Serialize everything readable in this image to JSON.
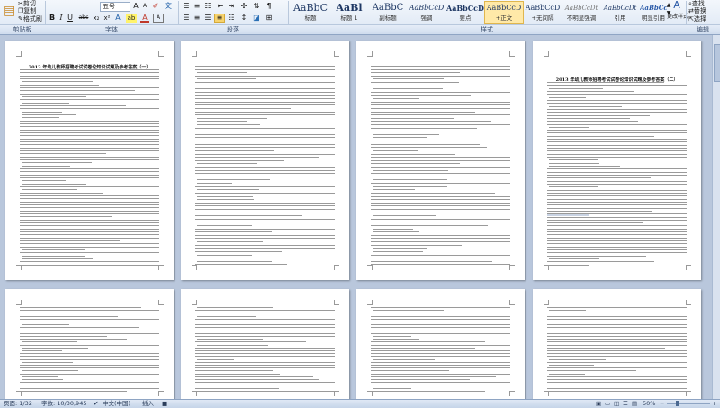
{
  "ribbon": {
    "clipboard": {
      "items": [
        "剪切",
        "复制",
        "格式刷"
      ],
      "label": "剪贴板"
    },
    "font": {
      "name_value": "五号",
      "label": "字体",
      "buttons": [
        "B",
        "I",
        "U",
        "abc",
        "x₂",
        "x²",
        "A"
      ]
    },
    "paragraph": {
      "label": "段落"
    },
    "styles": {
      "label": "样式",
      "tiles": [
        {
          "sample": "AaBbC",
          "name": "标题"
        },
        {
          "sample": "AaBl",
          "name": "标题 1"
        },
        {
          "sample": "AaBbC",
          "name": "副标题"
        },
        {
          "sample": "AaBbCcD",
          "name": "强调"
        },
        {
          "sample": "AaBbCcD",
          "name": "要点"
        },
        {
          "sample": "AaBbCcD",
          "name": "+正文"
        },
        {
          "sample": "AaBbCcD",
          "name": "+无间隔"
        },
        {
          "sample": "AaBbCcDt",
          "name": "不明显强调"
        },
        {
          "sample": "AaBbCcDt",
          "name": "引用"
        },
        {
          "sample": "AaBbCcDt",
          "name": "明显引用"
        }
      ],
      "change_label": "更改样式"
    },
    "editing": {
      "label": "编辑",
      "items": [
        "查找",
        "替换",
        "选择"
      ]
    }
  },
  "pages": {
    "p1_title": "2013 年幼儿教师招聘考试试卷论知识试题及参考答案（一）",
    "p4_title": "2013 年幼儿教师招聘考试试卷论知识试题及参考答案（二）"
  },
  "statusbar": {
    "page": "页面: 1/32",
    "words": "字数: 10/30,945",
    "language": "中文(中国)",
    "mode": "插入",
    "zoom": "50%"
  },
  "colors": {
    "ribbon_bg": "#dde7f4",
    "workspace_bg": "#b9c7dc",
    "active_style": "#ffe9a8"
  },
  "zoom_level": 0.5
}
